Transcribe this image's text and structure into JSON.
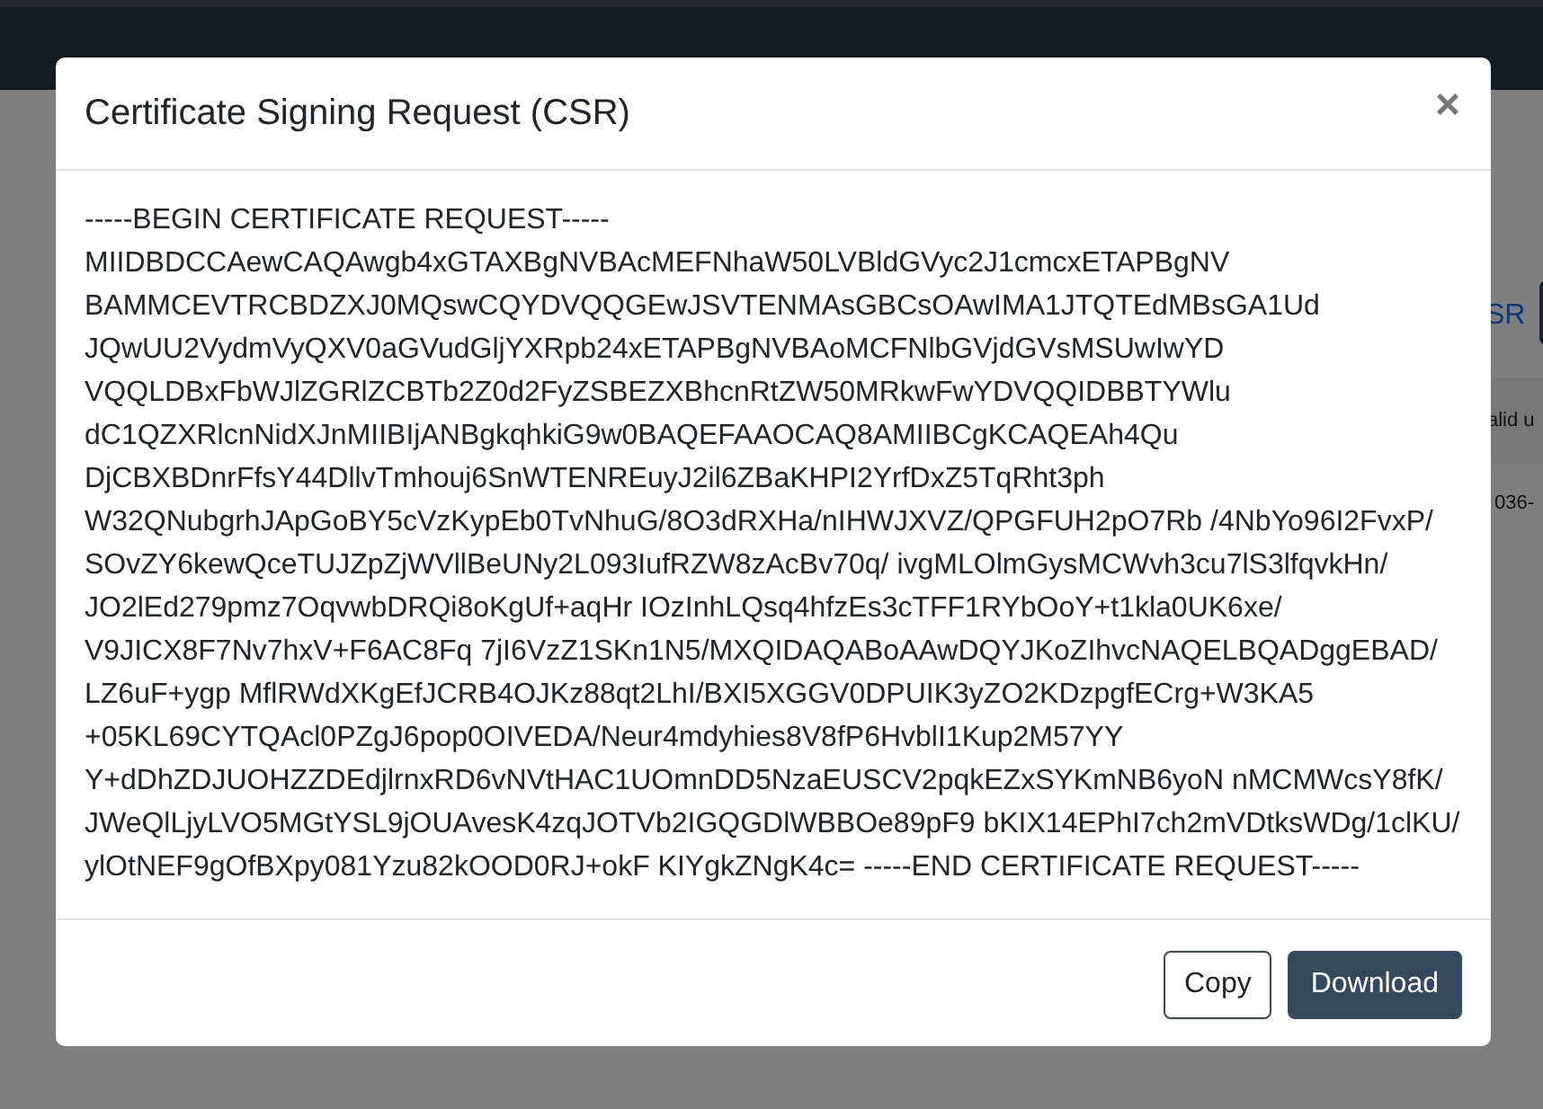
{
  "background_page": {
    "link": "SR",
    "column_header": "alid u",
    "cell": "036-"
  },
  "dialog": {
    "title": "Certificate Signing Request (CSR)",
    "close_symbol": "×",
    "csr_lines": [
      "-----BEGIN CERTIFICATE REQUEST-----",
      "MIIDBDCCAewCAQAwgb4xGTAXBgNVBAcMEFNhaW50LVBldGVyc2J1cmcxETAPBgNV",
      "BAMMCEVTRCBDZXJ0MQswCQYDVQQGEwJSVTENMAsGBCsOAwIMA1JTQTEdMBsGA1Ud",
      "JQwUU2VydmVyQXV0aGVudGljYXRpb24xETAPBgNVBAoMCFNlbGVjdGVsMSUwIwYD",
      "VQQLDBxFbWJlZGRlZCBTb2Z0d2FyZSBEZXBhcnRtZW50MRkwFwYDVQQIDBBTYWlu",
      "dC1QZXRlcnNidXJnMIIBIjANBgkqhkiG9w0BAQEFAAOCAQ8AMIIBCgKCAQEAh4Qu",
      "DjCBXBDnrFfsY44DllvTmhouj6SnWTENREuyJ2il6ZBaKHPI2YrfDxZ5TqRht3ph",
      "W32QNubgrhJApGoBY5cVzKypEb0TvNhuG/8O3dRXHa/nIHWJXVZ/QPGFUH2pO7Rb /4NbYo96I2FvxP/",
      "SOvZY6kewQceTUJZpZjWVllBeUNy2L093IufRZW8zAcBv70q/ ivgMLOlmGysMCWvh3cu7lS3lfqvkHn/",
      "JO2lEd279pmz7OqvwbDRQi8oKgUf+aqHr IOzInhLQsq4hfzEs3cTFF1RYbOoY+t1kla0UK6xe/",
      "V9JICX8F7Nv7hxV+F6AC8Fq 7jI6VzZ1SKn1N5/MXQIDAQABoAAwDQYJKoZIhvcNAQELBQADggEBAD/",
      "LZ6uF+ygp MflRWdXKgEfJCRB4OJKz88qt2LhI/BXI5XGGV0DPUIK3yZO2KDzpgfECrg+W3KA5",
      "+05KL69CYTQAcl0PZgJ6pop0OIVEDA/Neur4mdyhies8V8fP6HvblI1Kup2M57YY",
      "Y+dDhZDJUOHZZDEdjlrnxRD6vNVtHAC1UOmnDD5NzaEUSCV2pqkEZxSYKmNB6yoN nMCMWcsY8fK/",
      "JWeQlLjyLVO5MGtYSL9jOUAvesK4zqJOTVb2IGQGDlWBBOe89pF9 bKIX14EPhI7ch2mVDtksWDg/1clKU/",
      "ylOtNEF9gOfBXpy081Yzu82kOOD0RJ+okF KIYgkZNgK4c= -----END CERTIFICATE REQUEST-----"
    ],
    "buttons": [
      {
        "label": "Copy",
        "kind": "secondary"
      },
      {
        "label": "Download",
        "kind": "primary"
      }
    ]
  }
}
